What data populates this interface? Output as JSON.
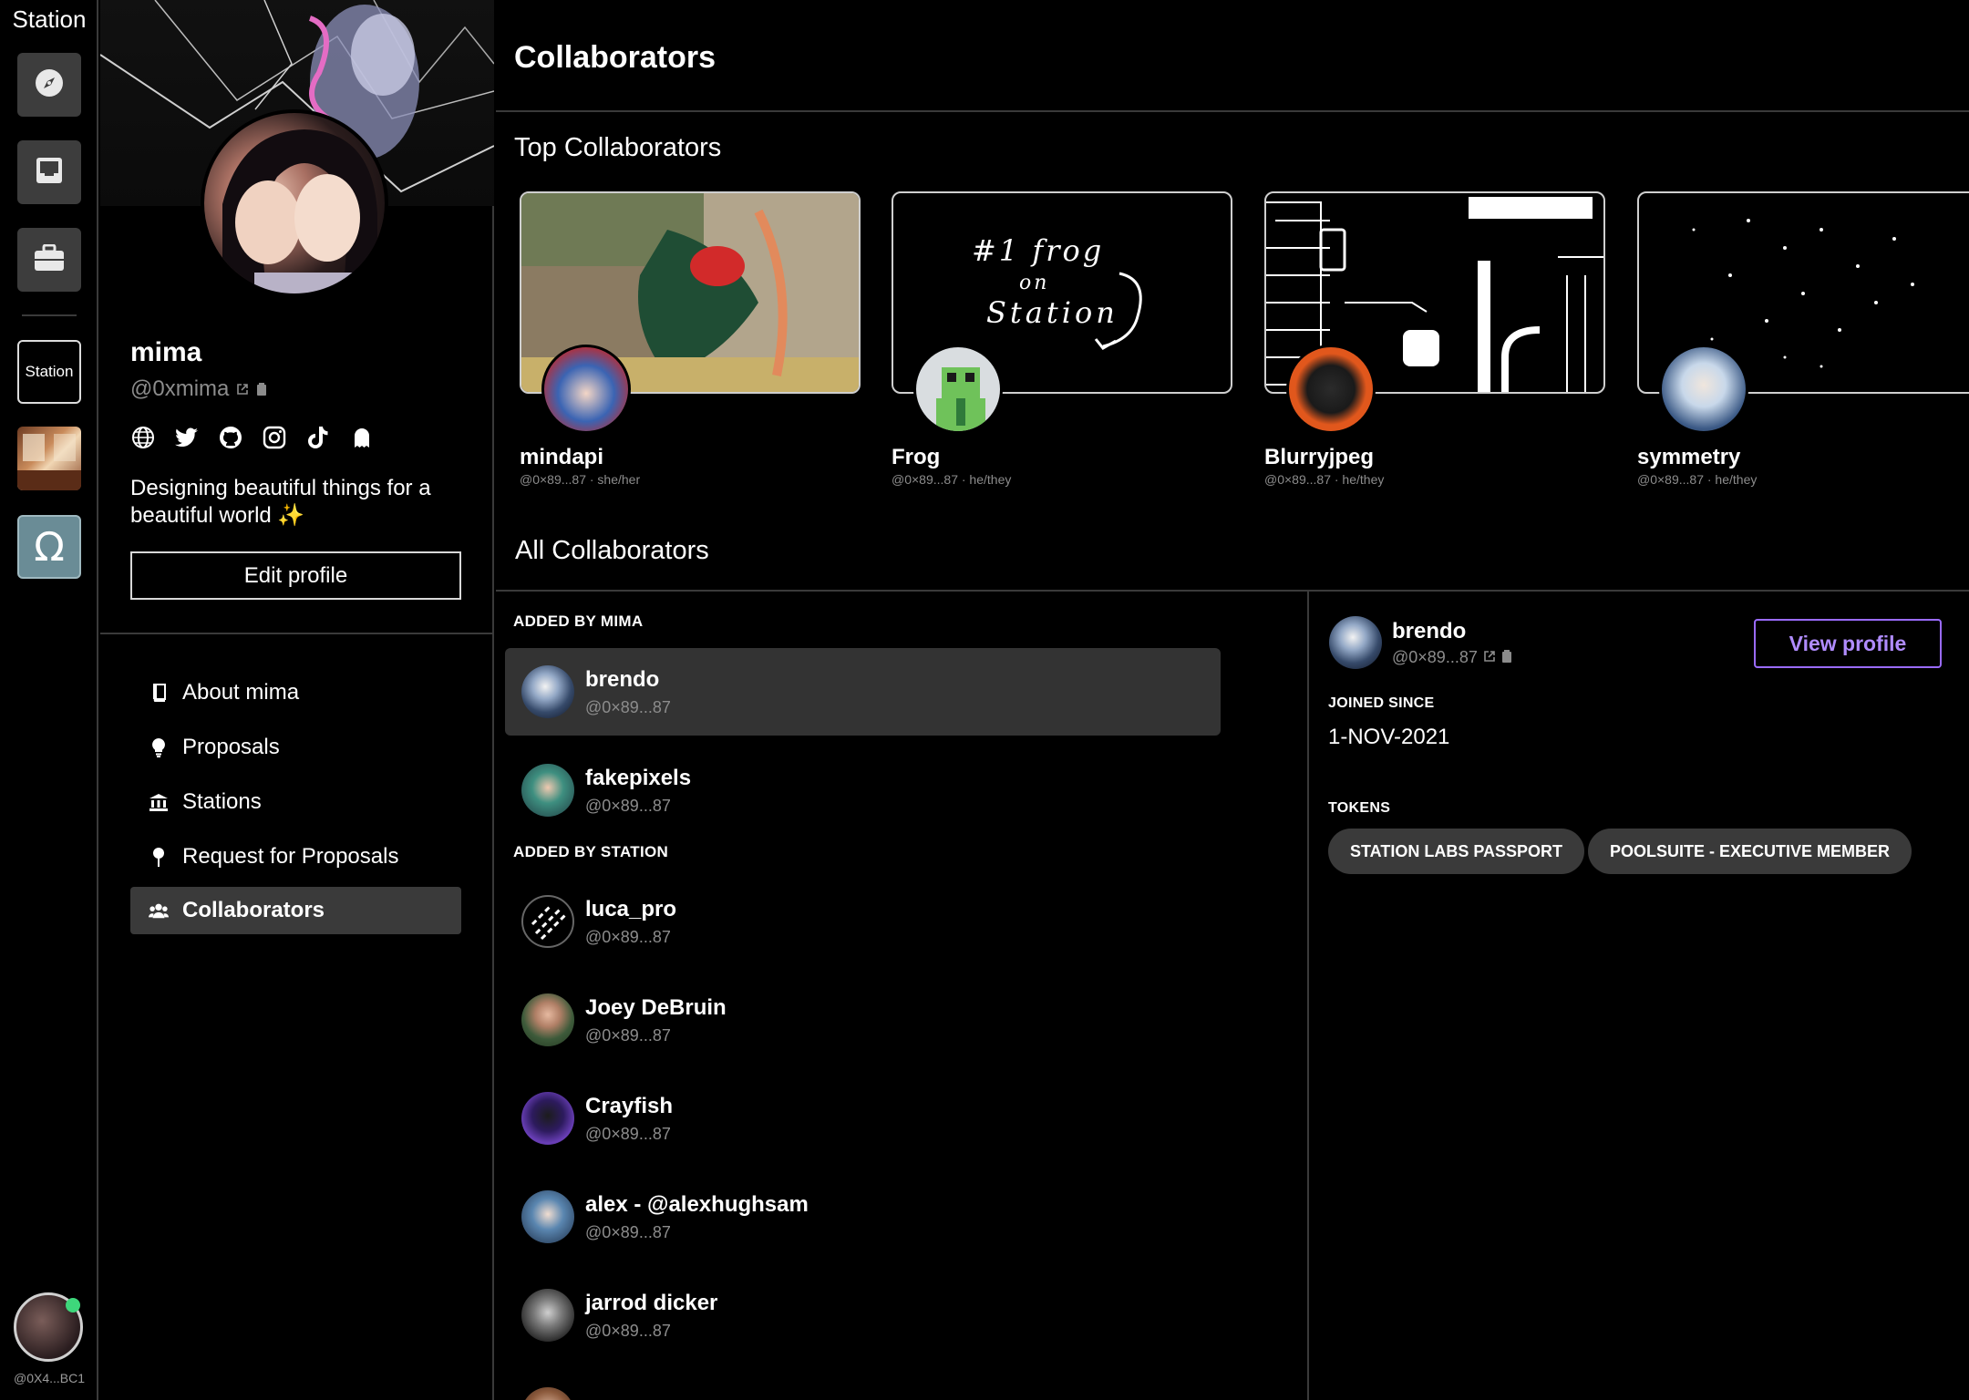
{
  "app": {
    "title": "Station",
    "user_address": "@0X4...BC1"
  },
  "rail": {
    "station_label": "Station"
  },
  "profile": {
    "name": "mima",
    "handle": "@0xmima",
    "bio": "Designing beautiful things for a beautiful world ✨",
    "edit_label": "Edit profile",
    "social_icons": [
      "globe-icon",
      "twitter-icon",
      "github-icon",
      "instagram-icon",
      "tiktok-icon",
      "ghost-icon"
    ]
  },
  "nav": {
    "items": [
      {
        "label": "About mima",
        "icon": "book-icon"
      },
      {
        "label": "Proposals",
        "icon": "lightbulb-icon"
      },
      {
        "label": "Stations",
        "icon": "bank-icon"
      },
      {
        "label": "Request for Proposals",
        "icon": "pin-icon"
      },
      {
        "label": "Collaborators",
        "icon": "people-icon",
        "active": true
      }
    ]
  },
  "main": {
    "title": "Collaborators",
    "top_heading": "Top Collaborators",
    "all_heading": "All Collaborators",
    "top_collaborators": [
      {
        "name": "mindapi",
        "sub": "@0×89...87 · she/her"
      },
      {
        "name": "Frog",
        "sub": "@0×89...87 · he/they"
      },
      {
        "name": "Blurryjpeg",
        "sub": "@0×89...87 · he/they"
      },
      {
        "name": "symmetry",
        "sub": "@0×89...87 · he/they"
      }
    ],
    "frog_card_text": [
      "#1 frog",
      "on",
      "Station"
    ],
    "groups": {
      "added_by_mima": "ADDED BY MIMA",
      "added_by_station": "ADDED BY STATION"
    },
    "rows": [
      {
        "name": "brendo",
        "handle": "@0×89...87"
      },
      {
        "name": "fakepixels",
        "handle": "@0×89...87"
      },
      {
        "name": "luca_pro",
        "handle": "@0×89...87"
      },
      {
        "name": "Joey DeBruin",
        "handle": "@0×89...87"
      },
      {
        "name": "Crayfish",
        "handle": "@0×89...87"
      },
      {
        "name": "alex - @alexhughsam",
        "handle": "@0×89...87"
      },
      {
        "name": "jarrod dicker",
        "handle": "@0×89...87"
      }
    ]
  },
  "detail": {
    "name": "brendo",
    "handle": "@0×89...87",
    "view_label": "View profile",
    "joined_label": "JOINED SINCE",
    "joined_value": "1-NOV-2021",
    "tokens_label": "TOKENS",
    "tokens": [
      "STATION LABS PASSPORT",
      "POOLSUITE - EXECUTIVE MEMBER"
    ]
  },
  "colors": {
    "accent": "#9a6bff",
    "online": "#3ed77b",
    "panel": "#3a3a3a"
  }
}
